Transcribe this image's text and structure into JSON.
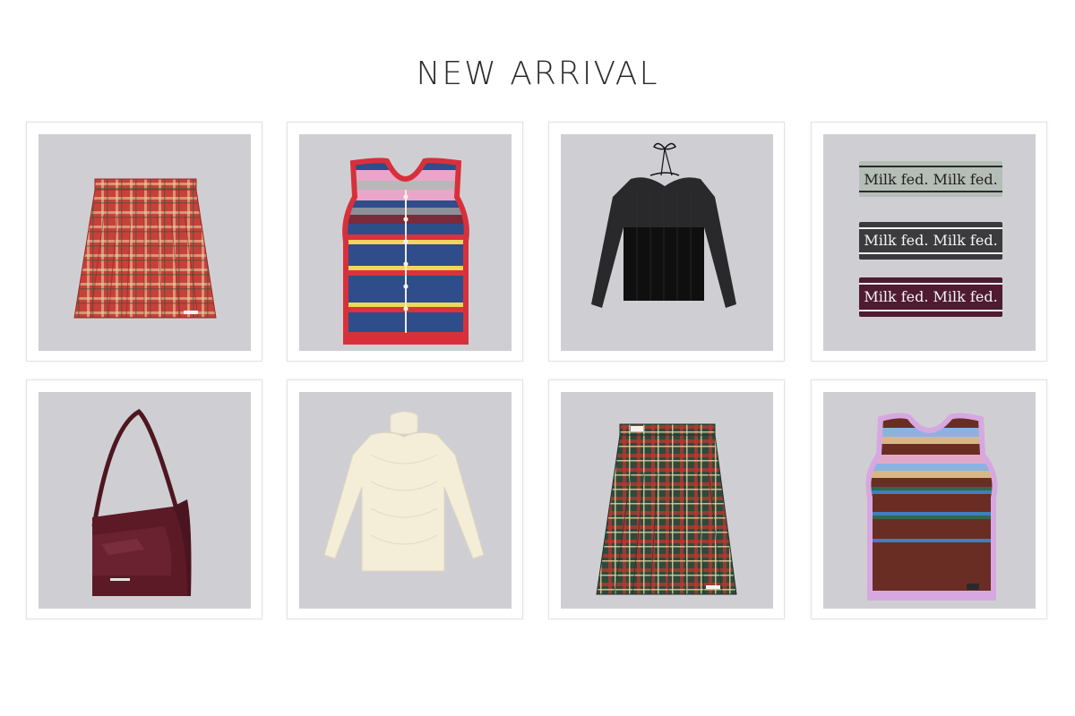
{
  "page": {
    "title": "NEW ARRIVAL"
  },
  "products": [
    {
      "id": "product-1",
      "kind": "red-tartan-pleated-skirt"
    },
    {
      "id": "product-2",
      "kind": "striped-knit-vest"
    },
    {
      "id": "product-3",
      "kind": "black-sheer-top"
    },
    {
      "id": "product-4",
      "kind": "logo-headbands",
      "headbands": [
        {
          "text": "Milk fed. Milk fed.",
          "color": "#b5bdb7"
        },
        {
          "text": "Milk fed. Milk fed.",
          "color": "#3b3b3d"
        },
        {
          "text": "Milk fed. Milk fed.",
          "color": "#4e1b31"
        }
      ]
    },
    {
      "id": "product-5",
      "kind": "burgundy-shoulder-bag"
    },
    {
      "id": "product-6",
      "kind": "cream-knit-top"
    },
    {
      "id": "product-7",
      "kind": "green-tartan-pleated-skirt"
    },
    {
      "id": "product-8",
      "kind": "brown-striped-knit-vest"
    }
  ],
  "colors": {
    "background": "#ffffff",
    "photo_background": "#cfcfd3",
    "title": "#2b2b2b"
  }
}
